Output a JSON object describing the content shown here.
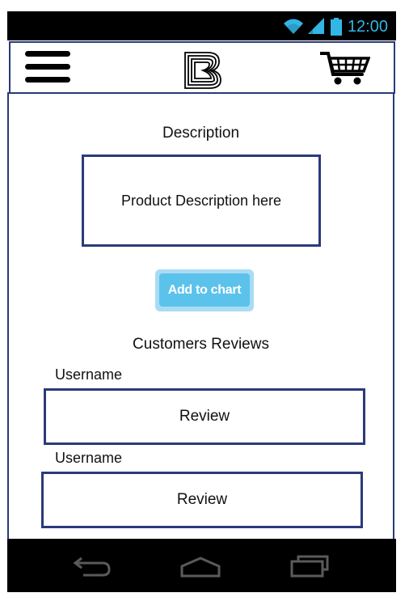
{
  "status_bar": {
    "time": "12:00",
    "icons": [
      "wifi-icon",
      "signal-icon",
      "battery-icon"
    ],
    "accent_color": "#33b5e5"
  },
  "header": {
    "menu_icon": "hamburger-menu-icon",
    "logo_icon": "b-logo-icon",
    "cart_icon": "shopping-cart-icon"
  },
  "description": {
    "title": "Description",
    "box_text": "Product Description here"
  },
  "add_button": {
    "label": "Add to chart",
    "color": "#5bc2ec"
  },
  "reviews": {
    "title": "Customers Reviews",
    "items": [
      {
        "username": "Username",
        "review": "Review"
      },
      {
        "username": "Username",
        "review": "Review"
      }
    ]
  },
  "nav_bar": {
    "icons": [
      "back-icon",
      "home-icon",
      "recent-apps-icon"
    ]
  },
  "colors": {
    "border": "#2a3a7a",
    "status_bar_bg": "#000000"
  }
}
